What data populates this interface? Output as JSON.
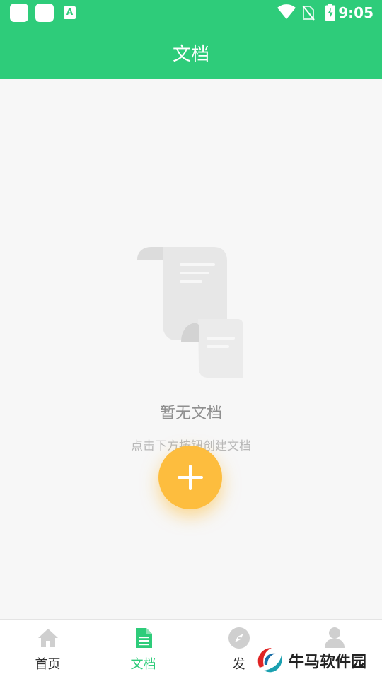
{
  "status_bar": {
    "time": "9:05",
    "input_badge": "A"
  },
  "app_bar": {
    "title": "文档"
  },
  "empty_state": {
    "title": "暂无文档",
    "hint": "点击下方按钮创建文档"
  },
  "fab": {
    "icon": "plus-icon",
    "color": "#fdbd3e"
  },
  "tabs": [
    {
      "label": "首页",
      "icon": "home-icon",
      "active": false
    },
    {
      "label": "文档",
      "icon": "document-icon",
      "active": true
    },
    {
      "label": "发",
      "icon": "compass-icon",
      "active": false
    },
    {
      "label": "",
      "icon": "person-icon",
      "active": false
    }
  ],
  "watermark": {
    "text": "牛马软件园"
  },
  "colors": {
    "primary": "#2ecc7a",
    "accent": "#fdbd3e",
    "background": "#f7f7f7"
  }
}
